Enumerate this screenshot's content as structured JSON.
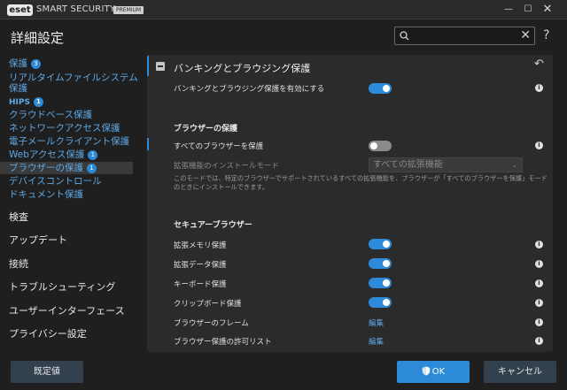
{
  "titlebar": {
    "logo": "eset",
    "product": "SMART SECURITY",
    "edition": "PREMIUM",
    "minimize": "—",
    "maximize": "☐",
    "close": "✕"
  },
  "header": {
    "title": "詳細設定",
    "search_placeholder": "",
    "search_clear": "✕",
    "help": "?"
  },
  "sidebar": {
    "items": [
      {
        "label": "保護",
        "badge": "3"
      },
      {
        "label": "リアルタイムファイルシステム"
      },
      {
        "label": "保護"
      },
      {
        "label": "HIPS",
        "badge": "1"
      },
      {
        "label": "クラウドベース保護"
      },
      {
        "label": "ネットワークアクセス保護"
      },
      {
        "label": "電子メールクライアント保護"
      },
      {
        "label": "Webアクセス保護",
        "badge": "1"
      },
      {
        "label": "ブラウザーの保護",
        "badge": "1"
      },
      {
        "label": "デバイスコントロール"
      },
      {
        "label": "ドキュメント保護"
      }
    ],
    "top_items": [
      "検査",
      "アップデート",
      "接続",
      "トラブルシューティング",
      "ユーザーインターフェース",
      "プライバシー設定"
    ]
  },
  "content": {
    "section_title": "バンキングとブラウジング保護",
    "undo": "↶",
    "enable_label": "バンキングとブラウジング保護を有効にする",
    "browser_group": "ブラウザーの保護",
    "all_browsers_label": "すべてのブラウザーを保護",
    "install_mode_label": "拡張機能のインストールモード",
    "install_mode_value": "すべての拡張機能",
    "install_mode_desc": "このモードでは、特定のブラウザーでサポートされているすべての拡張機能を、ブラウザーが「すべてのブラウザーを保護」モードのときにインストールできます。",
    "secure_group": "セキュアーブラウザー",
    "rows": [
      {
        "label": "拡張メモリ保護",
        "state": "on"
      },
      {
        "label": "拡張データ保護",
        "state": "on"
      },
      {
        "label": "キーボード保護",
        "state": "on"
      },
      {
        "label": "クリップボード保護",
        "state": "on"
      },
      {
        "label": "ブラウザーのフレーム",
        "link": "編集"
      },
      {
        "label": "ブラウザー保護の許可リスト",
        "link": "編集"
      }
    ]
  },
  "footer": {
    "default": "既定値",
    "ok": "OK",
    "cancel": "キャンセル"
  },
  "colors": {
    "accent": "#2d8ad8",
    "background": "#1f1f1f",
    "panel": "#2b2b2b"
  }
}
